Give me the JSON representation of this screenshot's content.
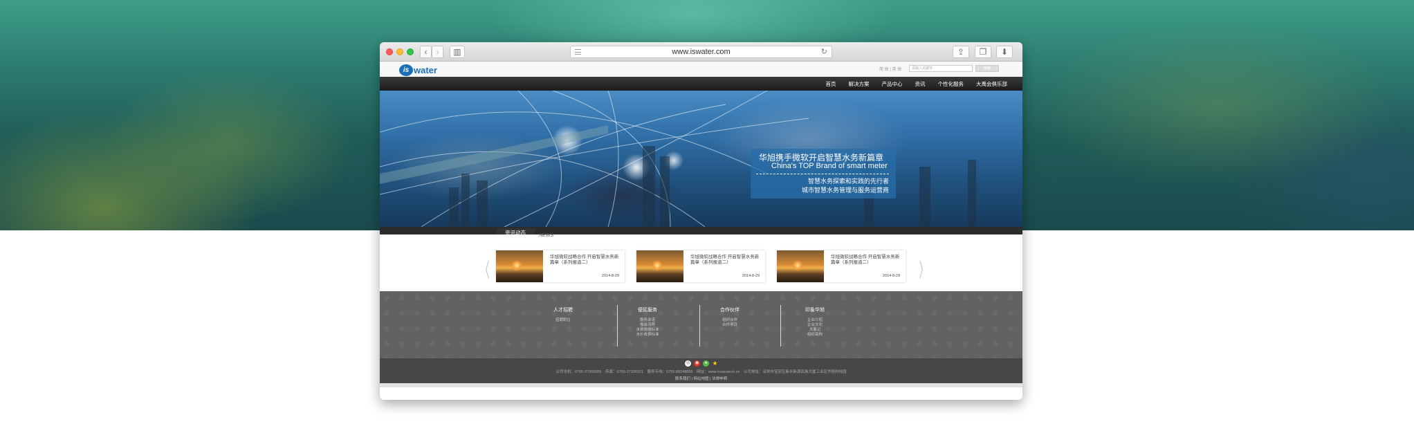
{
  "browser": {
    "url": "www.iswater.com",
    "back_icon": "chevron-left-icon",
    "forward_icon": "chevron-right-icon",
    "sidebar_icon": "sidebar-icon",
    "reload_icon": "reload-icon",
    "share_icon": "share-icon",
    "tabs_icon": "tabs-icon",
    "download_icon": "download-icon"
  },
  "header": {
    "logo_is": "is",
    "logo_water": "water",
    "top_links": "简 体 | 英 体",
    "search_placeholder": "请输入关键字",
    "search_button": "搜索"
  },
  "nav": {
    "items": [
      "首页",
      "解决方案",
      "产品中心",
      "资讯",
      "个性化服务",
      "大禹会俱乐部"
    ]
  },
  "banner": {
    "title_cn": "华旭携手微软开启智慧水务新篇章",
    "title_en": "China's TOP Brand of smart meter",
    "line1": "智慧水务探索和实践的先行者",
    "line2": "城市智慧水务管理与服务运营商"
  },
  "news": {
    "tab_label": "资讯动态",
    "tab_en": "NEWS",
    "prev": "〈",
    "next": "〉",
    "cards": [
      {
        "title": "华旭微软战略合作 开启智慧水务新篇章（系列报道二）",
        "date": "2014-8-29"
      },
      {
        "title": "华旭微软战略合作 开启智慧水务新篇章（系列报道二）",
        "date": "2014-8-29"
      },
      {
        "title": "华旭微软战略合作 开启智慧水务新篇章（系列报道二）",
        "date": "2014-8-29"
      }
    ]
  },
  "footer": {
    "columns": [
      {
        "heading": "人才招聘",
        "items": [
          "招聘职位"
        ]
      },
      {
        "heading": "便民服务",
        "items": [
          "服务承诺",
          "报装流程",
          "水费收缴标准",
          "水价收费标准"
        ]
      },
      {
        "heading": "合作伙伴",
        "items": [
          "组织伙伴",
          "合作项目"
        ]
      },
      {
        "heading": "印象华旭",
        "items": [
          "企业介绍",
          "企业文化",
          "大事记",
          "组织架构"
        ]
      }
    ],
    "info": "公司总机：0755-27066555　传真：0755-27306921　服务专线：0755-88248855　网址：www.huaxutech.cn　公司地址：深圳市宝安区新水新源民族大厦工业区华旭科技园",
    "links": "联系我们 | 网站地图 | 法律申明"
  }
}
